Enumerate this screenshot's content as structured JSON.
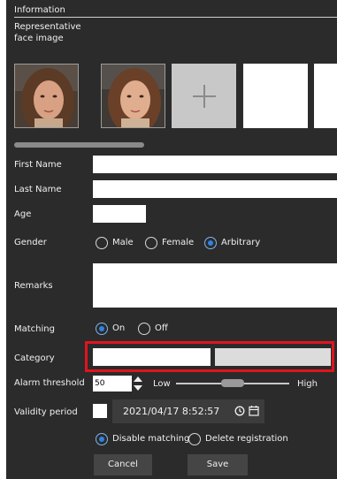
{
  "section_title": "Information",
  "representative_face": {
    "label_line1": "Representative",
    "label_line2": "face image",
    "add_symbol": "+"
  },
  "fields": {
    "first_name": {
      "label": "First Name",
      "value": ""
    },
    "last_name": {
      "label": "Last Name",
      "value": ""
    },
    "age": {
      "label": "Age",
      "value": ""
    },
    "gender": {
      "label": "Gender",
      "options": [
        "Male",
        "Female",
        "Arbitrary"
      ],
      "selected": "Arbitrary"
    },
    "remarks": {
      "label": "Remarks",
      "value": ""
    },
    "matching": {
      "label": "Matching",
      "options": [
        "On",
        "Off"
      ],
      "selected": "On"
    },
    "category": {
      "label": "Category",
      "value": ""
    },
    "alarm_threshold": {
      "label": "Alarm threshold",
      "value": "50",
      "low_label": "Low",
      "high_label": "High",
      "level": 0.5
    },
    "validity_period": {
      "label": "Validity period",
      "datetime": "2021/04/17 8:52:57",
      "options": [
        "Disable matching",
        "Delete registration"
      ],
      "selected": "Disable matching"
    }
  },
  "buttons": {
    "cancel": "Cancel",
    "save": "Save"
  },
  "colors": {
    "panel": "#2b2b2b",
    "highlight": "#e0141e",
    "radio_accent": "#2f84e0"
  }
}
